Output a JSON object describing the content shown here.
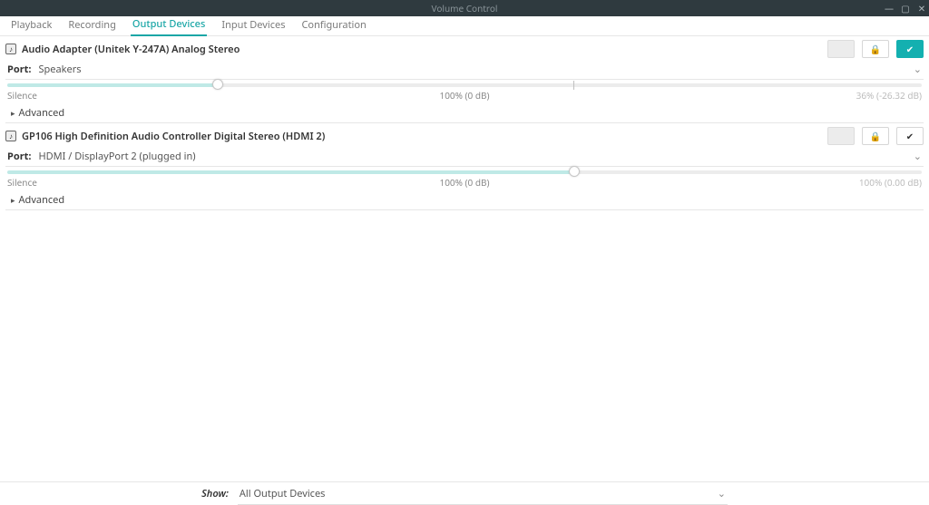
{
  "window": {
    "title": "Volume Control"
  },
  "tabs": {
    "items": [
      {
        "label": "Playback",
        "active": false
      },
      {
        "label": "Recording",
        "active": false
      },
      {
        "label": "Output Devices",
        "active": true
      },
      {
        "label": "Input Devices",
        "active": false
      },
      {
        "label": "Configuration",
        "active": false
      }
    ]
  },
  "devices": [
    {
      "name": "Audio Adapter (Unitek Y-247A) Analog Stereo",
      "port_label": "Port:",
      "port_value": "Speakers",
      "slider_percent": 23,
      "labels": {
        "left": "Silence",
        "center": "100% (0 dB)",
        "right": "36% (-26.32 dB)"
      },
      "advanced": "Advanced",
      "default": true
    },
    {
      "name": "GP106 High Definition Audio Controller Digital Stereo (HDMI 2)",
      "port_label": "Port:",
      "port_value": "HDMI / DisplayPort 2 (plugged in)",
      "slider_percent": 62,
      "labels": {
        "left": "Silence",
        "center": "100% (0 dB)",
        "right": "100% (0.00 dB)"
      },
      "advanced": "Advanced",
      "default": false
    }
  ],
  "bottom": {
    "label": "Show:",
    "value": "All Output Devices"
  }
}
